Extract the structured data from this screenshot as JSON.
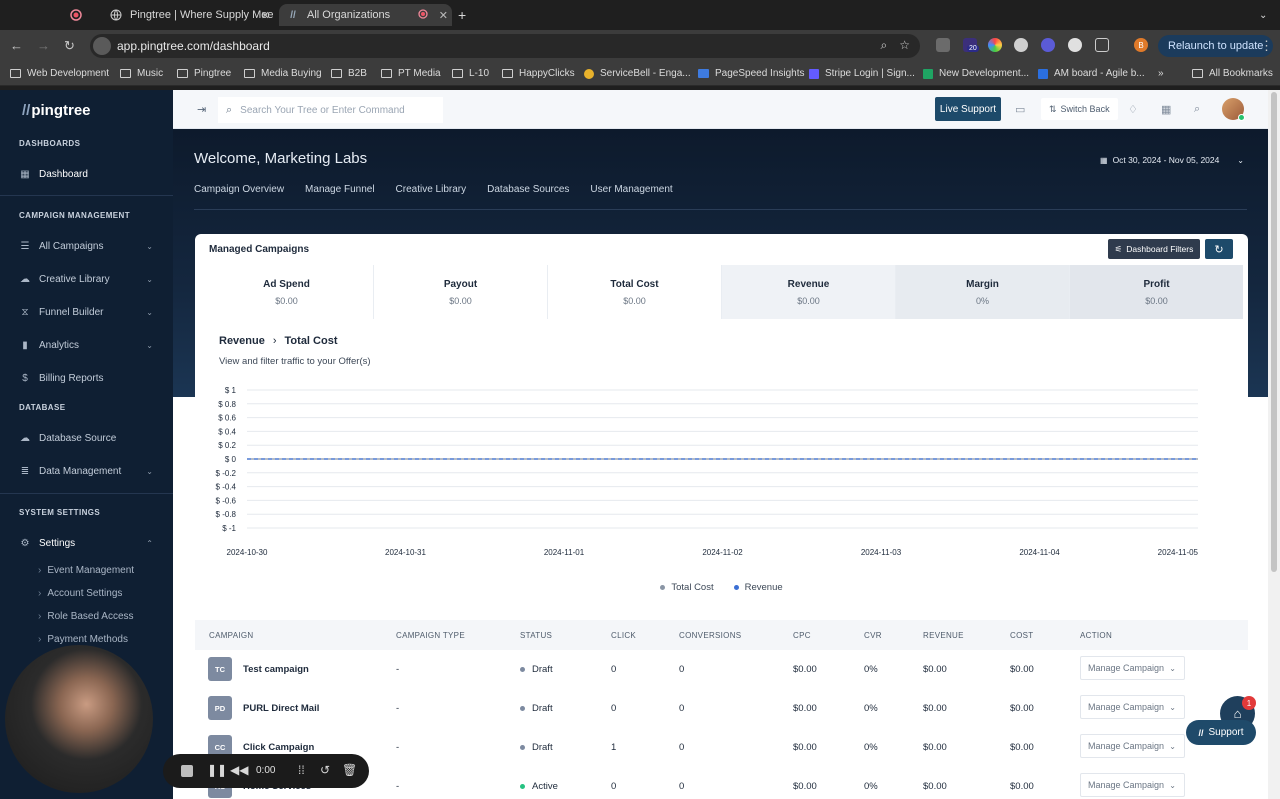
{
  "browser": {
    "tabs": [
      {
        "title": "",
        "icon": "record-icon"
      },
      {
        "title": "Pingtree | Where Supply Mee",
        "icon": "globe-icon"
      },
      {
        "title": "All Organizations",
        "icon": "pingtree-icon"
      }
    ],
    "url": "app.pingtree.com/dashboard",
    "profile_initial": "B",
    "ext_badge": "20",
    "relaunch_label": "Relaunch to update",
    "bookmarks": [
      "Web Development",
      "Music",
      "Pingtree",
      "Media Buying",
      "B2B",
      "PT Media",
      "L-10",
      "HappyClicks",
      "ServiceBell - Enga...",
      "PageSpeed Insights",
      "Stripe Login | Sign...",
      "New Development...",
      "AM board - Agile b..."
    ],
    "all_bookmarks": "All Bookmarks"
  },
  "sidebar": {
    "logo": "pingtree",
    "sections": {
      "dashboards": "DASHBOARDS",
      "campaign_management": "CAMPAIGN MANAGEMENT",
      "database": "DATABASE",
      "system_settings": "SYSTEM SETTINGS"
    },
    "items": {
      "dashboard": "Dashboard",
      "all_campaigns": "All Campaigns",
      "creative_library": "Creative Library",
      "funnel_builder": "Funnel Builder",
      "analytics": "Analytics",
      "billing_reports": "Billing Reports",
      "database_source": "Database Source",
      "data_management": "Data Management",
      "settings": "Settings"
    },
    "settings_sub": [
      "Event Management",
      "Account Settings",
      "Role Based Access",
      "Payment Methods"
    ]
  },
  "topbar": {
    "search_placeholder": "Search Your Tree or Enter Command",
    "live_support": "Live Support",
    "switch_back": "Switch Back"
  },
  "hero": {
    "welcome": "Welcome, Marketing Labs",
    "date_range": "Oct 30, 2024 - Nov 05, 2024",
    "tabs": [
      "Campaign Overview",
      "Manage Funnel",
      "Creative Library",
      "Database Sources",
      "User Management"
    ]
  },
  "card": {
    "title": "Managed Campaigns",
    "filters_label": "Dashboard Filters",
    "stats": [
      {
        "label": "Ad Spend",
        "value": "$0.00"
      },
      {
        "label": "Payout",
        "value": "$0.00"
      },
      {
        "label": "Total Cost",
        "value": "$0.00"
      },
      {
        "label": "Revenue",
        "value": "$0.00"
      },
      {
        "label": "Margin",
        "value": "0%"
      },
      {
        "label": "Profit",
        "value": "$0.00"
      }
    ],
    "chart_title_a": "Revenue",
    "chart_title_b": "Total Cost",
    "chart_subtitle": "View and filter traffic to your Offer(s)"
  },
  "chart_data": {
    "type": "line",
    "x": [
      "2024-10-30",
      "2024-10-31",
      "2024-11-01",
      "2024-11-02",
      "2024-11-03",
      "2024-11-04",
      "2024-11-05"
    ],
    "series": [
      {
        "name": "Total Cost",
        "values": [
          0,
          0,
          0,
          0,
          0,
          0,
          0
        ],
        "color": "#8a95a5"
      },
      {
        "name": "Revenue",
        "values": [
          0,
          0,
          0,
          0,
          0,
          0,
          0
        ],
        "color": "#3b6fd4"
      }
    ],
    "y_ticks": [
      "$ 1",
      "$ 0.8",
      "$ 0.6",
      "$ 0.4",
      "$ 0.2",
      "$ 0",
      "$ -0.2",
      "$ -0.4",
      "$ -0.6",
      "$ -0.8",
      "$ -1"
    ],
    "ylim": [
      -1,
      1
    ],
    "grid": true,
    "legend": "bottom-center"
  },
  "table": {
    "headers": [
      "CAMPAIGN",
      "CAMPAIGN TYPE",
      "STATUS",
      "CLICK",
      "CONVERSIONS",
      "CPC",
      "CVR",
      "REVENUE",
      "COST",
      "ACTION"
    ],
    "rows": [
      {
        "initials": "TC",
        "name": "Test campaign",
        "type": "-",
        "status": "Draft",
        "click": "0",
        "conversions": "0",
        "cpc": "$0.00",
        "cvr": "0%",
        "revenue": "$0.00",
        "cost": "$0.00",
        "action": "Manage Campaign"
      },
      {
        "initials": "PD",
        "name": "PURL Direct Mail",
        "type": "-",
        "status": "Draft",
        "click": "0",
        "conversions": "0",
        "cpc": "$0.00",
        "cvr": "0%",
        "revenue": "$0.00",
        "cost": "$0.00",
        "action": "Manage Campaign"
      },
      {
        "initials": "CC",
        "name": "Click Campaign",
        "type": "-",
        "status": "Draft",
        "click": "1",
        "conversions": "0",
        "cpc": "$0.00",
        "cvr": "0%",
        "revenue": "$0.00",
        "cost": "$0.00",
        "action": "Manage Campaign"
      },
      {
        "initials": "HS",
        "name": "Home Services",
        "type": "-",
        "status": "Active",
        "click": "0",
        "conversions": "0",
        "cpc": "$0.00",
        "cvr": "0%",
        "revenue": "$0.00",
        "cost": "$0.00",
        "action": "Manage Campaign"
      }
    ],
    "status_colors": {
      "Draft": "#7d8aa0",
      "Active": "#26c281"
    }
  },
  "overlays": {
    "rec_time": "0:00",
    "chat_badge": "1",
    "support_label": "Support"
  }
}
